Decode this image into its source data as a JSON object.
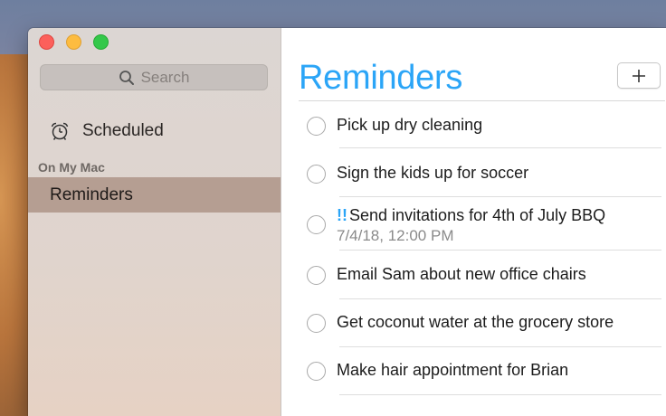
{
  "window": {
    "title": "Reminders"
  },
  "sidebar": {
    "search_placeholder": "Search",
    "smart_lists": [
      {
        "label": "Scheduled",
        "icon": "alarm-clock-icon"
      }
    ],
    "section_header": "On My Mac",
    "lists": [
      {
        "label": "Reminders",
        "selected": true
      }
    ]
  },
  "main": {
    "title": "Reminders",
    "add_button_icon": "plus-icon",
    "accent_color": "#2ba5f7",
    "items": [
      {
        "title": "Pick up dry cleaning",
        "priority": "",
        "due": "",
        "completed": false
      },
      {
        "title": "Sign the kids up for soccer",
        "priority": "",
        "due": "",
        "completed": false
      },
      {
        "title": "Send invitations for 4th of July BBQ",
        "priority": "!!",
        "due": "7/4/18, 12:00 PM",
        "completed": false
      },
      {
        "title": "Email Sam about new office chairs",
        "priority": "",
        "due": "",
        "completed": false
      },
      {
        "title": "Get coconut water at the grocery store",
        "priority": "",
        "due": "",
        "completed": false
      },
      {
        "title": "Make hair appointment for Brian",
        "priority": "",
        "due": "",
        "completed": false
      }
    ]
  }
}
